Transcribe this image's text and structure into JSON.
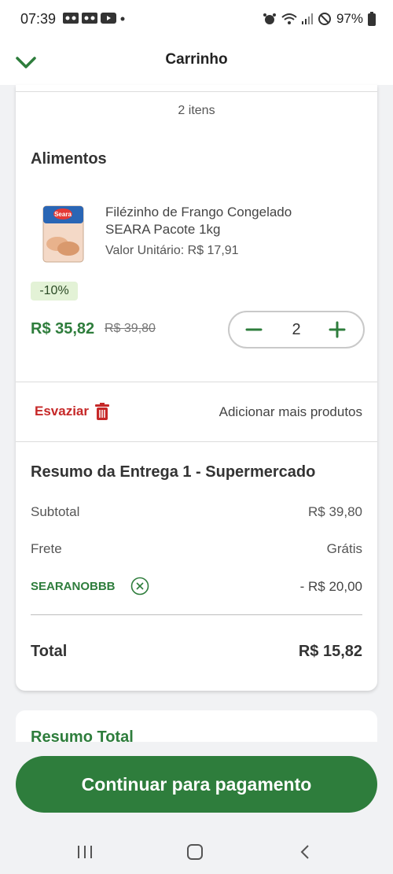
{
  "status_bar": {
    "time": "07:39",
    "battery": "97%"
  },
  "header": {
    "title": "Carrinho"
  },
  "cart": {
    "item_count": "2 itens",
    "category": "Alimentos",
    "product": {
      "name_line1": "Filézinho de Frango Congelado",
      "name_line2": "SEARA Pacote 1kg",
      "unit_price": "Valor Unitário: R$ 17,91",
      "discount_badge": "-10%",
      "price": "R$ 35,82",
      "old_price": "R$ 39,80",
      "quantity": "2",
      "brand_logo": "Seara"
    },
    "empty_label": "Esvaziar",
    "add_more_label": "Adicionar mais produtos"
  },
  "delivery_summary": {
    "title": "Resumo da Entrega 1 - Supermercado",
    "subtotal_label": "Subtotal",
    "subtotal_value": "R$ 39,80",
    "shipping_label": "Frete",
    "shipping_value": "Grátis",
    "coupon_code": "SEARANOBBB",
    "coupon_value": "- R$ 20,00",
    "total_label": "Total",
    "total_value": "R$ 15,82"
  },
  "total_summary": {
    "title": "Resumo Total"
  },
  "cta": {
    "label": "Continuar para pagamento"
  },
  "colors": {
    "accent": "#2e7d3c",
    "danger": "#c62828",
    "badge_bg": "#e3f2d6"
  }
}
